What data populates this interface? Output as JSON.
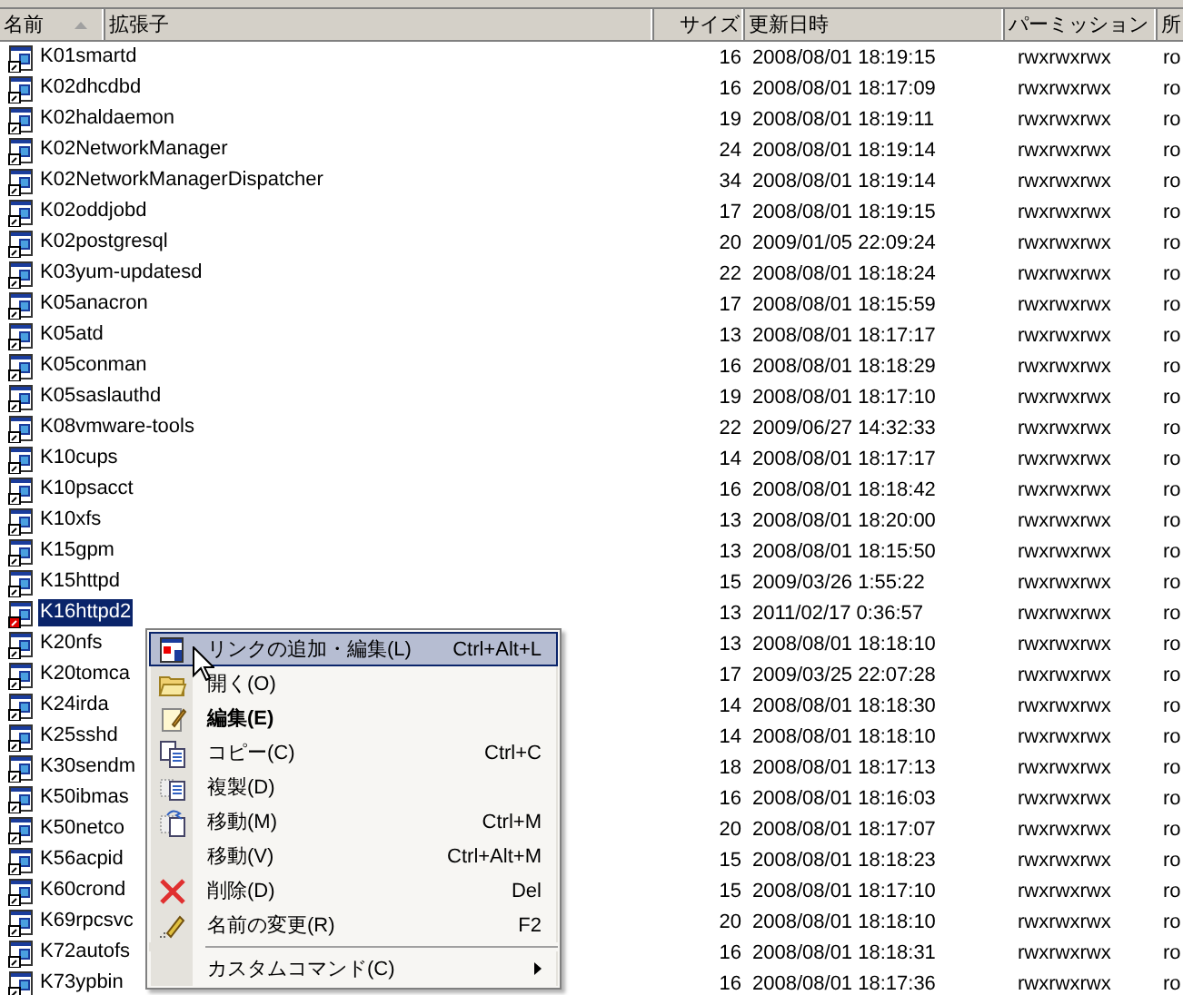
{
  "columns": [
    {
      "label": "名前",
      "sorted": true
    },
    {
      "label": "拡張子",
      "sorted": false
    },
    {
      "label": "サイズ",
      "sorted": false
    },
    {
      "label": "更新日時",
      "sorted": false
    },
    {
      "label": "パーミッション",
      "sorted": false
    },
    {
      "label": "所",
      "sorted": false
    }
  ],
  "rows": [
    {
      "name": "K01smartd",
      "size": "16",
      "modified": "2008/08/01 18:19:15",
      "permission": "rwxrwxrwx",
      "owner": "ro",
      "selected": false,
      "marked": false
    },
    {
      "name": "K02dhcdbd",
      "size": "16",
      "modified": "2008/08/01 18:17:09",
      "permission": "rwxrwxrwx",
      "owner": "ro",
      "selected": false,
      "marked": false
    },
    {
      "name": "K02haldaemon",
      "size": "19",
      "modified": "2008/08/01 18:19:11",
      "permission": "rwxrwxrwx",
      "owner": "ro",
      "selected": false,
      "marked": false
    },
    {
      "name": "K02NetworkManager",
      "size": "24",
      "modified": "2008/08/01 18:19:14",
      "permission": "rwxrwxrwx",
      "owner": "ro",
      "selected": false,
      "marked": false
    },
    {
      "name": "K02NetworkManagerDispatcher",
      "size": "34",
      "modified": "2008/08/01 18:19:14",
      "permission": "rwxrwxrwx",
      "owner": "ro",
      "selected": false,
      "marked": false
    },
    {
      "name": "K02oddjobd",
      "size": "17",
      "modified": "2008/08/01 18:19:15",
      "permission": "rwxrwxrwx",
      "owner": "ro",
      "selected": false,
      "marked": false
    },
    {
      "name": "K02postgresql",
      "size": "20",
      "modified": "2009/01/05 22:09:24",
      "permission": "rwxrwxrwx",
      "owner": "ro",
      "selected": false,
      "marked": false
    },
    {
      "name": "K03yum-updatesd",
      "size": "22",
      "modified": "2008/08/01 18:18:24",
      "permission": "rwxrwxrwx",
      "owner": "ro",
      "selected": false,
      "marked": false
    },
    {
      "name": "K05anacron",
      "size": "17",
      "modified": "2008/08/01 18:15:59",
      "permission": "rwxrwxrwx",
      "owner": "ro",
      "selected": false,
      "marked": false
    },
    {
      "name": "K05atd",
      "size": "13",
      "modified": "2008/08/01 18:17:17",
      "permission": "rwxrwxrwx",
      "owner": "ro",
      "selected": false,
      "marked": false
    },
    {
      "name": "K05conman",
      "size": "16",
      "modified": "2008/08/01 18:18:29",
      "permission": "rwxrwxrwx",
      "owner": "ro",
      "selected": false,
      "marked": false
    },
    {
      "name": "K05saslauthd",
      "size": "19",
      "modified": "2008/08/01 18:17:10",
      "permission": "rwxrwxrwx",
      "owner": "ro",
      "selected": false,
      "marked": false
    },
    {
      "name": "K08vmware-tools",
      "size": "22",
      "modified": "2009/06/27 14:32:33",
      "permission": "rwxrwxrwx",
      "owner": "ro",
      "selected": false,
      "marked": false
    },
    {
      "name": "K10cups",
      "size": "14",
      "modified": "2008/08/01 18:17:17",
      "permission": "rwxrwxrwx",
      "owner": "ro",
      "selected": false,
      "marked": false
    },
    {
      "name": "K10psacct",
      "size": "16",
      "modified": "2008/08/01 18:18:42",
      "permission": "rwxrwxrwx",
      "owner": "ro",
      "selected": false,
      "marked": false
    },
    {
      "name": "K10xfs",
      "size": "13",
      "modified": "2008/08/01 18:20:00",
      "permission": "rwxrwxrwx",
      "owner": "ro",
      "selected": false,
      "marked": false
    },
    {
      "name": "K15gpm",
      "size": "13",
      "modified": "2008/08/01 18:15:50",
      "permission": "rwxrwxrwx",
      "owner": "ro",
      "selected": false,
      "marked": false
    },
    {
      "name": "K15httpd",
      "size": "15",
      "modified": "2009/03/26 1:55:22",
      "permission": "rwxrwxrwx",
      "owner": "ro",
      "selected": false,
      "marked": false
    },
    {
      "name": "K16httpd2",
      "size": "13",
      "modified": "2011/02/17 0:36:57",
      "permission": "rwxrwxrwx",
      "owner": "ro",
      "selected": true,
      "marked": true
    },
    {
      "name": "K20nfs",
      "size": "13",
      "modified": "2008/08/01 18:18:10",
      "permission": "rwxrwxrwx",
      "owner": "ro",
      "selected": false,
      "marked": false
    },
    {
      "name": "K20tomca",
      "size": "17",
      "modified": "2009/03/25 22:07:28",
      "permission": "rwxrwxrwx",
      "owner": "ro",
      "selected": false,
      "marked": false
    },
    {
      "name": "K24irda",
      "size": "14",
      "modified": "2008/08/01 18:18:30",
      "permission": "rwxrwxrwx",
      "owner": "ro",
      "selected": false,
      "marked": false
    },
    {
      "name": "K25sshd",
      "size": "14",
      "modified": "2008/08/01 18:18:10",
      "permission": "rwxrwxrwx",
      "owner": "ro",
      "selected": false,
      "marked": false
    },
    {
      "name": "K30sendm",
      "size": "18",
      "modified": "2008/08/01 18:17:13",
      "permission": "rwxrwxrwx",
      "owner": "ro",
      "selected": false,
      "marked": false
    },
    {
      "name": "K50ibmas",
      "size": "16",
      "modified": "2008/08/01 18:16:03",
      "permission": "rwxrwxrwx",
      "owner": "ro",
      "selected": false,
      "marked": false
    },
    {
      "name": "K50netco",
      "size": "20",
      "modified": "2008/08/01 18:17:07",
      "permission": "rwxrwxrwx",
      "owner": "ro",
      "selected": false,
      "marked": false
    },
    {
      "name": "K56acpid",
      "size": "15",
      "modified": "2008/08/01 18:18:23",
      "permission": "rwxrwxrwx",
      "owner": "ro",
      "selected": false,
      "marked": false
    },
    {
      "name": "K60crond",
      "size": "15",
      "modified": "2008/08/01 18:17:10",
      "permission": "rwxrwxrwx",
      "owner": "ro",
      "selected": false,
      "marked": false
    },
    {
      "name": "K69rpcsvc",
      "size": "20",
      "modified": "2008/08/01 18:18:10",
      "permission": "rwxrwxrwx",
      "owner": "ro",
      "selected": false,
      "marked": false
    },
    {
      "name": "K72autofs",
      "size": "16",
      "modified": "2008/08/01 18:18:31",
      "permission": "rwxrwxrwx",
      "owner": "ro",
      "selected": false,
      "marked": false
    },
    {
      "name": "K73ypbin",
      "size": "16",
      "modified": "2008/08/01 18:17:36",
      "permission": "rwxrwxrwx",
      "owner": "ro",
      "selected": false,
      "marked": false
    }
  ],
  "context_menu": [
    {
      "kind": "link",
      "label": "リンクの追加・編集(L)",
      "shortcut": "Ctrl+Alt+L",
      "selected": true,
      "bold": false
    },
    {
      "kind": "open",
      "label": "開く(O)",
      "selected": false,
      "bold": false
    },
    {
      "kind": "edit",
      "label": "編集(E)",
      "selected": false,
      "bold": true
    },
    {
      "kind": "copy",
      "label": "コピー(C)",
      "shortcut": "Ctrl+C",
      "selected": false,
      "bold": false
    },
    {
      "kind": "duplicate",
      "label": "複製(D)",
      "selected": false,
      "bold": false
    },
    {
      "kind": "move",
      "label": "移動(M)",
      "shortcut": "Ctrl+M",
      "selected": false,
      "bold": false
    },
    {
      "kind": "plain",
      "label": "移動(V)",
      "shortcut": "Ctrl+Alt+M",
      "selected": false,
      "bold": false
    },
    {
      "kind": "delete",
      "label": "削除(D)",
      "shortcut": "Del",
      "selected": false,
      "bold": false
    },
    {
      "kind": "rename",
      "label": "名前の変更(R)",
      "shortcut": "F2",
      "selected": false,
      "bold": false
    },
    {
      "kind": "separator"
    },
    {
      "kind": "submenu",
      "label": "カスタムコマンド(C)",
      "selected": false,
      "bold": false
    }
  ]
}
